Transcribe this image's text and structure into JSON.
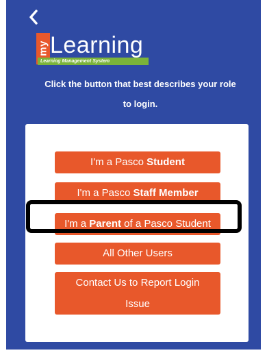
{
  "header": {
    "back_icon": "chevron-left-icon"
  },
  "logo": {
    "my": "my",
    "learning": "Learning",
    "tagline": "Learning Management System"
  },
  "instruction": {
    "line1": "Click the button that best describes your role",
    "line2": "to login."
  },
  "buttons": {
    "student": {
      "prefix": "I'm a Pasco ",
      "bold": "Student",
      "suffix": ""
    },
    "staff": {
      "prefix": "I'm a Pasco ",
      "bold": "Staff Member",
      "suffix": ""
    },
    "parent": {
      "prefix": "I'm a ",
      "bold": "Parent",
      "suffix": " of a Pasco Student"
    },
    "other": {
      "label": "All Other Users"
    },
    "contact": {
      "line1": "Contact Us to Report Login",
      "line2": "Issue"
    }
  },
  "colors": {
    "background": "#2f4aa3",
    "button": "#e8582b",
    "logo_bar": "#7bb33a",
    "highlight": "#000000"
  }
}
